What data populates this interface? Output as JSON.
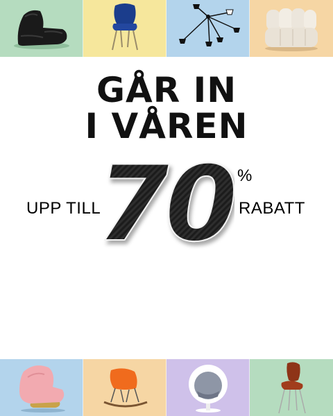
{
  "headline": {
    "line1": "GÅR IN",
    "line2": "I VÅREN"
  },
  "offer": {
    "prefix": "UPP TILL",
    "value": "70",
    "unit": "%",
    "suffix": "RABATT"
  },
  "colors": {
    "mint": "#b5dcbf",
    "butter": "#f6e79c",
    "sky": "#b3d4ec",
    "peach": "#f6d6a4",
    "lavender": "#cfc1ea",
    "black": "#111111"
  },
  "tiles_top": [
    {
      "icon": "black-lounge-chair-icon"
    },
    {
      "icon": "blue-dining-chair-icon"
    },
    {
      "icon": "black-spider-ceiling-lamp-icon"
    },
    {
      "icon": "white-boucle-sofa-icon"
    }
  ],
  "tiles_bottom": [
    {
      "icon": "pink-lounge-chair-icon"
    },
    {
      "icon": "orange-rocking-chair-icon"
    },
    {
      "icon": "white-ball-chair-icon"
    },
    {
      "icon": "brown-leather-chair-icon"
    }
  ]
}
